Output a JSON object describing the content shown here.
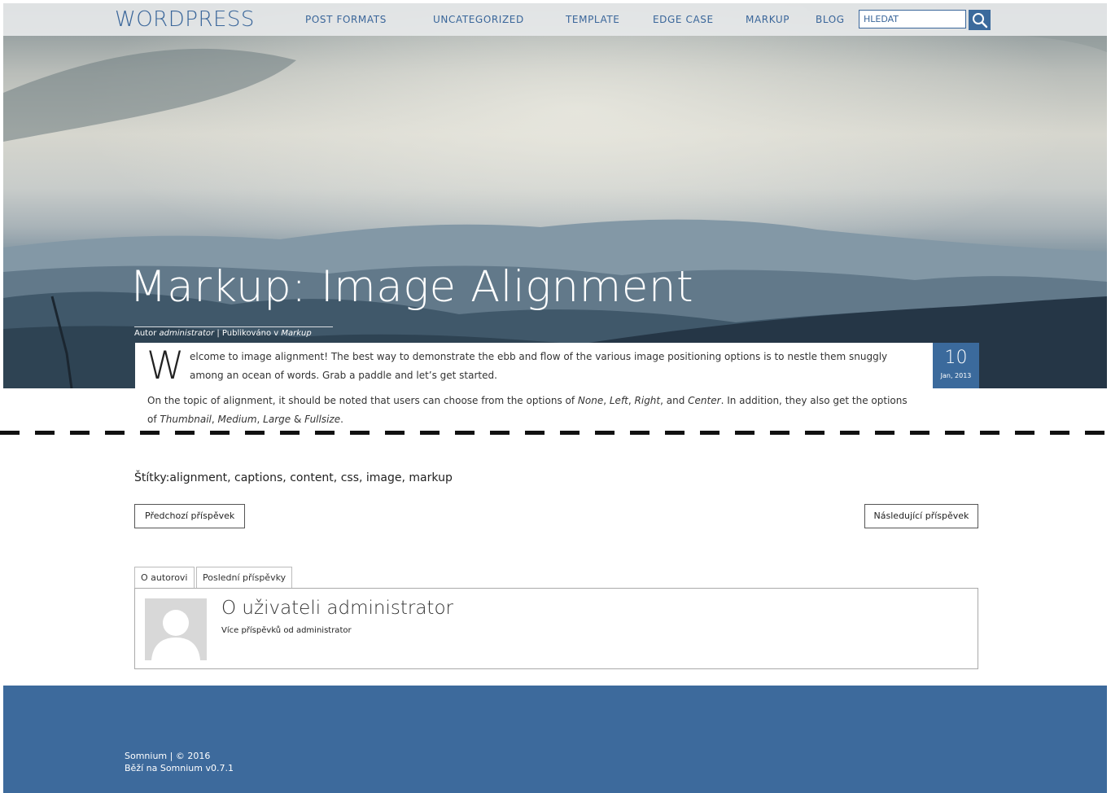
{
  "header": {
    "brand": "WORDPRESS",
    "nav": [
      "POST FORMATS",
      "UNCATEGORIZED",
      "TEMPLATE",
      "EDGE CASE",
      "MARKUP",
      "BLOG"
    ],
    "search_placeholder": "HLEDAT",
    "search_icon": "search-icon"
  },
  "post": {
    "title": "Markup: Image Alignment",
    "meta": {
      "author_prefix": "Autor",
      "author": "administrator",
      "separator": " | ",
      "published_prefix": "Publikováno v",
      "category": "Markup"
    },
    "date": {
      "day": "10",
      "month": "Jan, 2013"
    },
    "dropcap": "W",
    "intro_line1": "elcome to image alignment! The best way to demonstrate the ebb and flow of the various image positioning options is to nestle them snuggly",
    "intro_line2": "among an ocean of words. Grab a paddle and let’s get started.",
    "p2_line1": {
      "a": "On the topic of alignment, it should be noted that users can choose from the options of",
      "none": "None",
      "left": "Left",
      "right": "Right",
      "and": "and",
      "center": "Center",
      "b": ". In addition, they also get the options"
    },
    "p2_line2": {
      "of": "of",
      "thumbnail": "Thumbnail",
      "medium": "Medium",
      "large": "Large",
      "amp": "&",
      "fullsize": "Fullsize"
    }
  },
  "tags": {
    "label": "Štítky:",
    "items": [
      "alignment",
      "captions",
      "content",
      "css",
      "image",
      "markup"
    ]
  },
  "pagination": {
    "prev": "Předchozí příspěvek",
    "next": "Následující příspěvek"
  },
  "author_box": {
    "tabs": [
      "O autorovi",
      "Poslední příspěvky"
    ],
    "heading": "O uživateli administrator",
    "link": "Více příspěvků od administrator"
  },
  "footer": {
    "line1": "Somnium | © 2016",
    "line2": "Běží na Somnium v0.7.1"
  },
  "colors": {
    "accent": "#3b6a9c",
    "footer": "#3d6a9c"
  }
}
